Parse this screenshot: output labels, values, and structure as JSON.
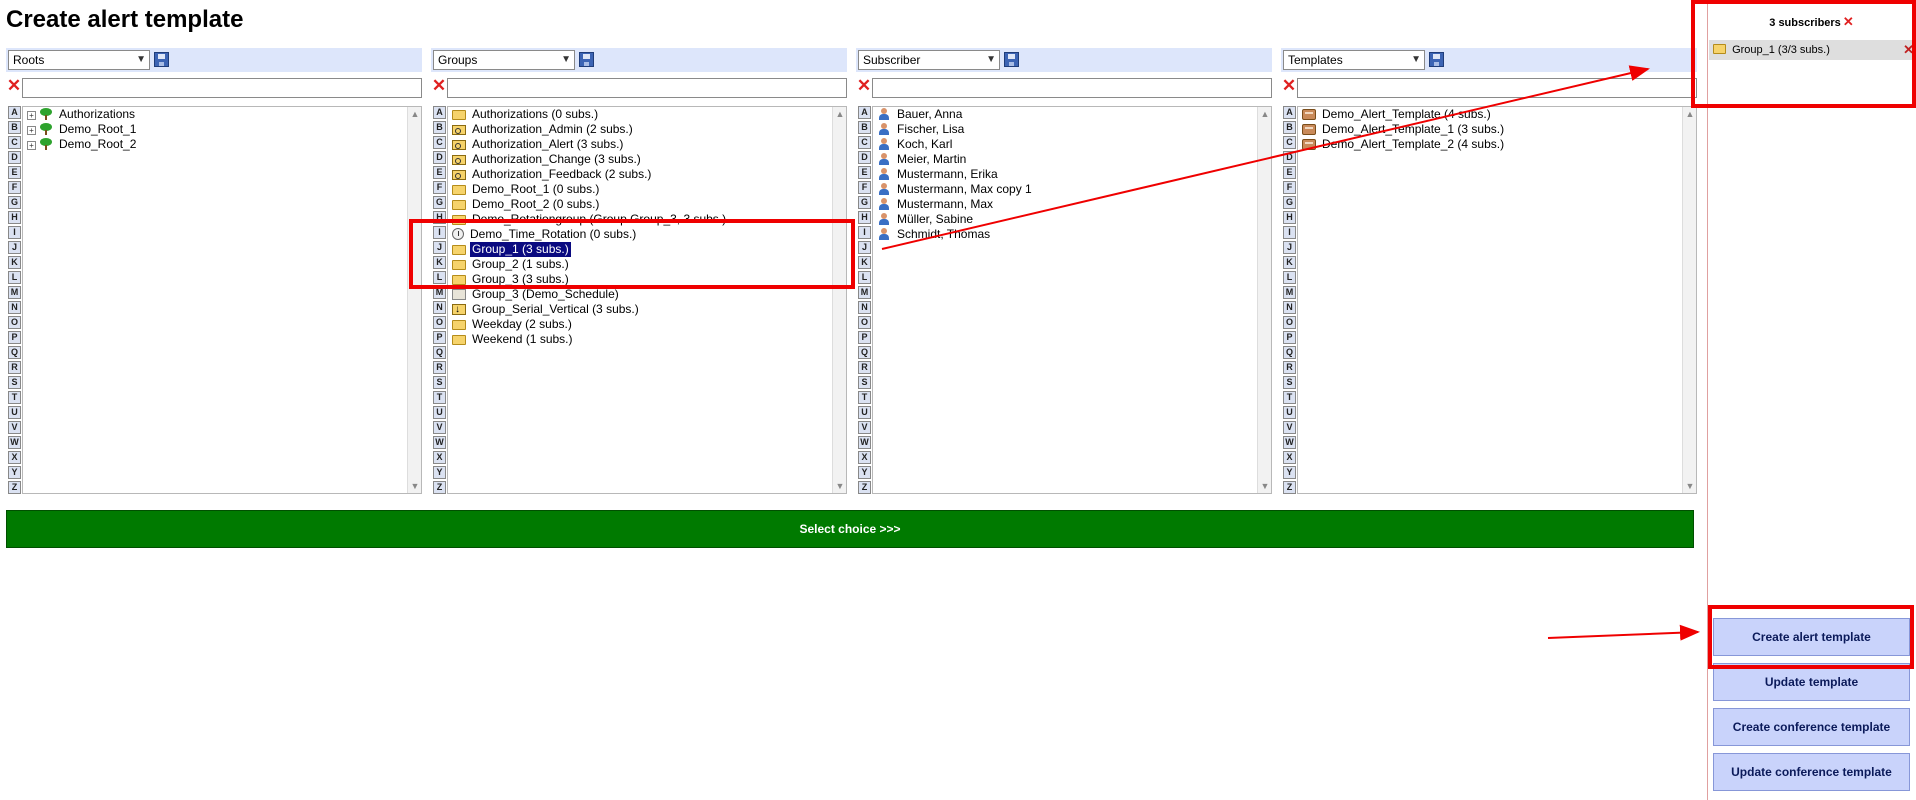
{
  "page": {
    "title": "Create alert template"
  },
  "panels": [
    {
      "select": "Roots",
      "filter": "",
      "rows": [
        {
          "label": "Authorizations",
          "icon": "tree-icon",
          "expander": "+"
        },
        {
          "label": "Demo_Root_1",
          "icon": "tree-icon",
          "expander": "+"
        },
        {
          "label": "Demo_Root_2",
          "icon": "tree-icon",
          "expander": "+"
        }
      ]
    },
    {
      "select": "Groups",
      "filter": "",
      "rows": [
        {
          "label": "Authorizations (0 subs.)",
          "icon": "folder-icon"
        },
        {
          "label": "Authorization_Admin (2 subs.)",
          "icon": "key-icon"
        },
        {
          "label": "Authorization_Alert (3 subs.)",
          "icon": "key-icon"
        },
        {
          "label": "Authorization_Change (3 subs.)",
          "icon": "key-icon"
        },
        {
          "label": "Authorization_Feedback (2 subs.)",
          "icon": "key-icon"
        },
        {
          "label": "Demo_Root_1 (0 subs.)",
          "icon": "folder-icon"
        },
        {
          "label": "Demo_Root_2 (0 subs.)",
          "icon": "folder-icon"
        },
        {
          "label": "Demo_Rotationgroup (Group Group_3, 3 subs.)",
          "icon": "folder-icon"
        },
        {
          "label": "Demo_Time_Rotation (0 subs.)",
          "icon": "clock-icon"
        },
        {
          "label": "Group_1 (3 subs.)",
          "icon": "folder-icon",
          "selected": true
        },
        {
          "label": "Group_2 (1 subs.)",
          "icon": "folder-icon"
        },
        {
          "label": "Group_3 (3 subs.)",
          "icon": "folder-icon"
        },
        {
          "label": "Group_3 (Demo_Schedule)",
          "icon": "schedule-icon"
        },
        {
          "label": "Group_Serial_Vertical (3 subs.)",
          "icon": "serial-icon"
        },
        {
          "label": "Weekday (2 subs.)",
          "icon": "folder-icon"
        },
        {
          "label": "Weekend (1 subs.)",
          "icon": "folder-icon"
        }
      ]
    },
    {
      "select": "Subscriber",
      "filter": "",
      "rows": [
        {
          "label": "Bauer, Anna",
          "icon": "person-icon"
        },
        {
          "label": "Fischer, Lisa",
          "icon": "person-icon"
        },
        {
          "label": "Koch, Karl",
          "icon": "person-icon"
        },
        {
          "label": "Meier, Martin",
          "icon": "person-icon"
        },
        {
          "label": "Mustermann, Erika",
          "icon": "person-icon"
        },
        {
          "label": "Mustermann, Max copy 1",
          "icon": "person-icon"
        },
        {
          "label": "Mustermann, Max",
          "icon": "person-icon"
        },
        {
          "label": "Müller, Sabine",
          "icon": "person-icon"
        },
        {
          "label": "Schmidt, Thomas",
          "icon": "person-icon"
        }
      ]
    },
    {
      "select": "Templates",
      "filter": "",
      "rows": [
        {
          "label": "Demo_Alert_Template (4 subs.)",
          "icon": "template-icon"
        },
        {
          "label": "Demo_Alert_Template_1 (3 subs.)",
          "icon": "template-icon"
        },
        {
          "label": "Demo_Alert_Template_2 (4 subs.)",
          "icon": "template-icon"
        }
      ]
    }
  ],
  "alphabet": [
    "A",
    "B",
    "C",
    "D",
    "E",
    "F",
    "G",
    "H",
    "I",
    "J",
    "K",
    "L",
    "M",
    "N",
    "O",
    "P",
    "Q",
    "R",
    "S",
    "T",
    "U",
    "V",
    "W",
    "X",
    "Y",
    "Z"
  ],
  "select_choice_label": "Select choice >>>",
  "subscribers": {
    "header": "3 subscribers",
    "items": [
      {
        "label": "Group_1 (3/3 subs.)",
        "icon": "folder-icon"
      }
    ]
  },
  "actions": {
    "create_alert": "Create alert template",
    "update": "Update template",
    "create_conference": "Create conference template",
    "update_conference": "Update conference template"
  },
  "colors": {
    "annotation": "#ef0000",
    "select_choice_bg": "#007a00",
    "action_bg": "#c9d3fb",
    "selected_row": "#0a0a80"
  }
}
